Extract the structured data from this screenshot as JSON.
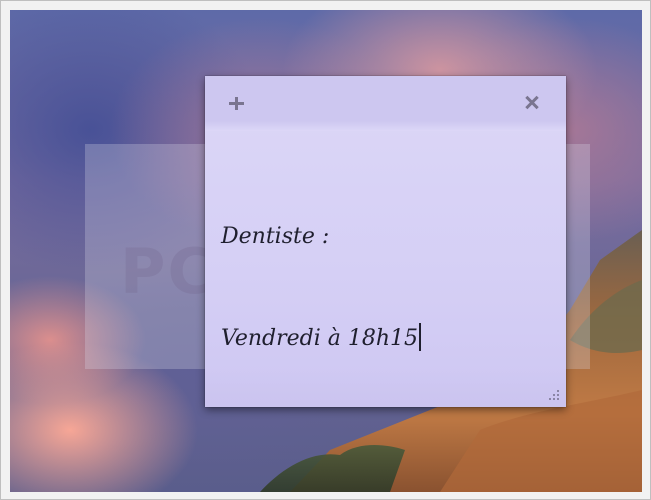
{
  "sticky_note": {
    "add_glyph": "+",
    "close_glyph": "×",
    "lines": [
      "Dentiste :",
      "Vendredi à 18h15"
    ],
    "background_color": "#d5cff5",
    "header_color": "#cdc7f0"
  },
  "watermark": {
    "text": "PC ASTUCES"
  },
  "icons": {
    "add": "plus-icon",
    "close": "close-icon",
    "resize": "resize-grip-icon"
  }
}
